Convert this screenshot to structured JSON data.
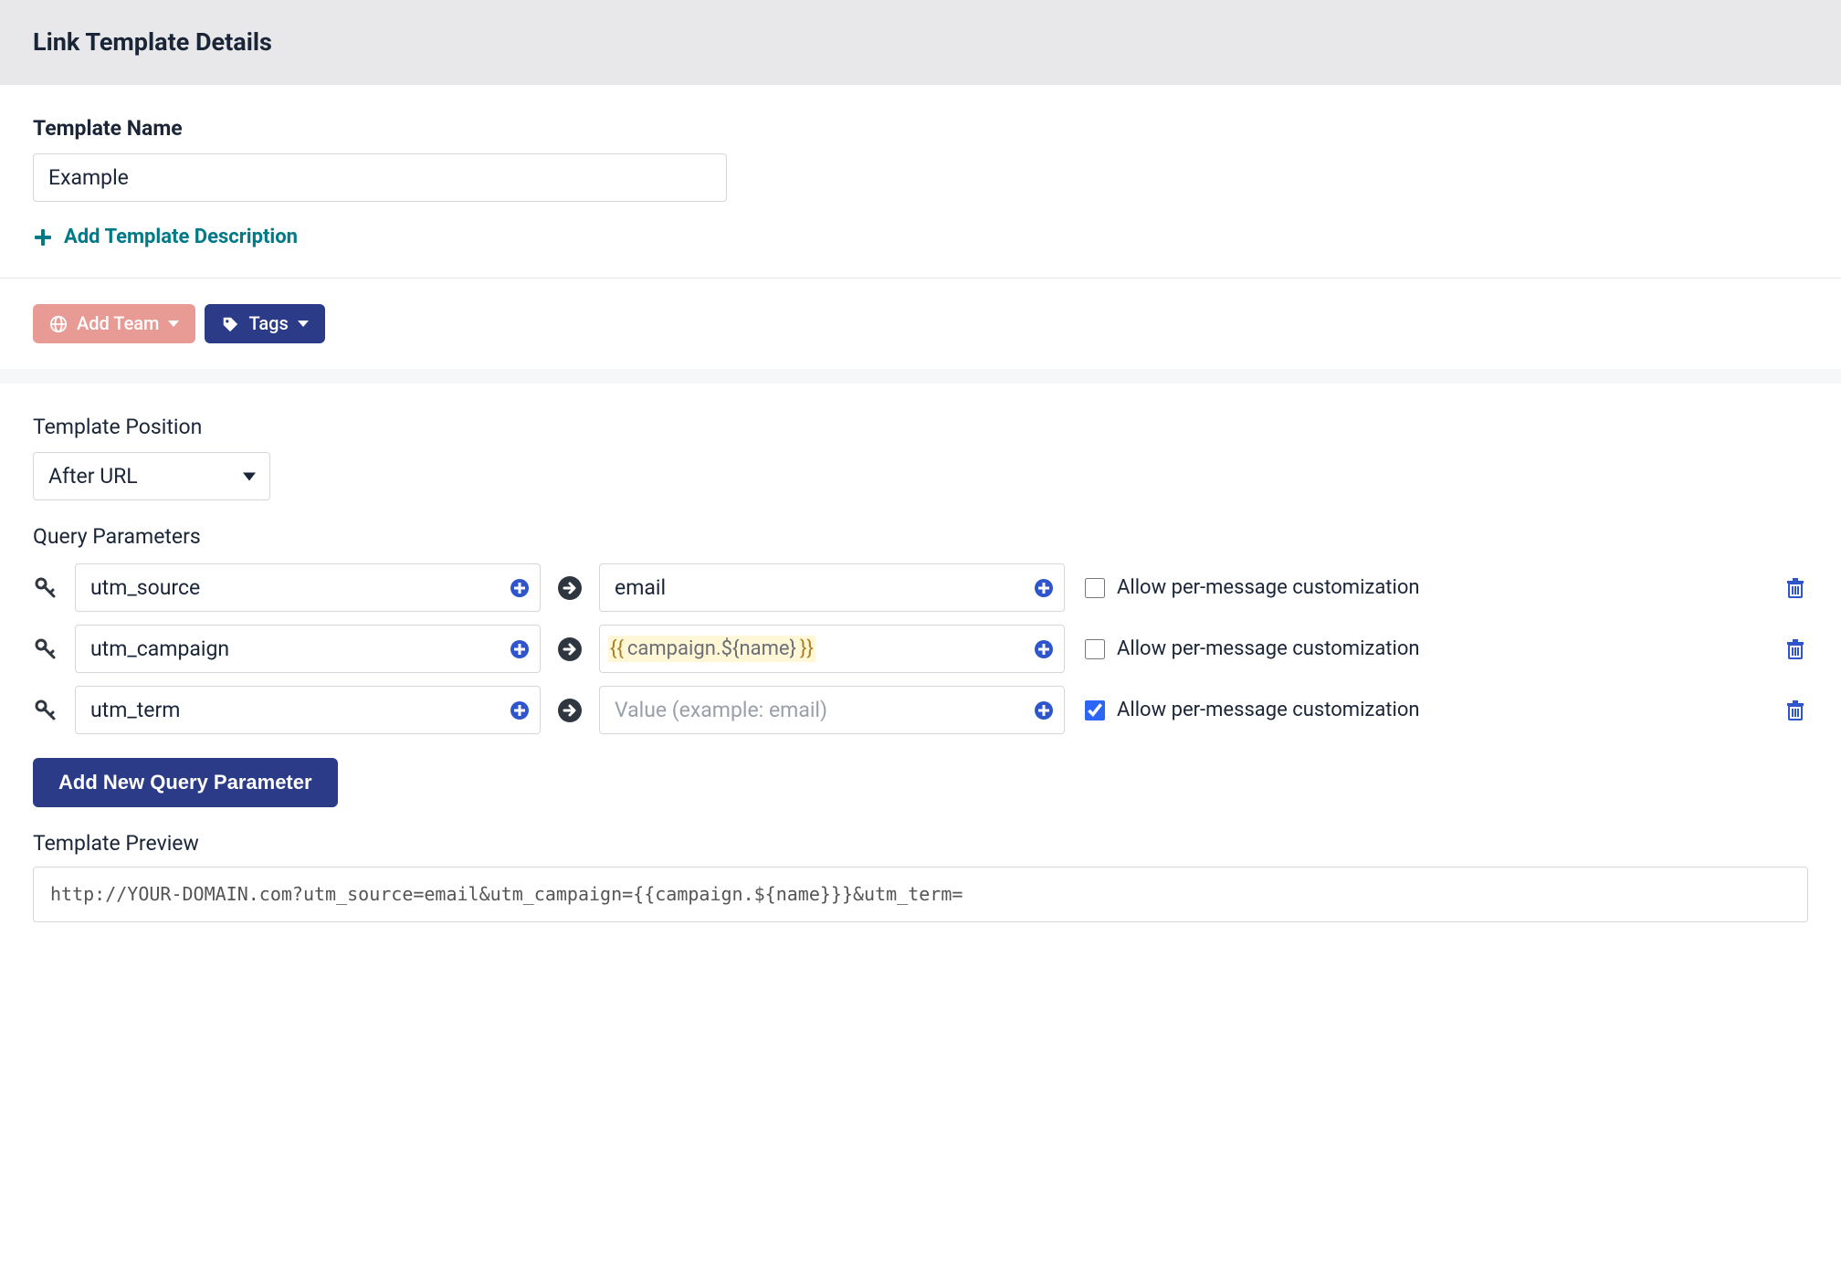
{
  "header": {
    "title": "Link Template Details"
  },
  "template_name": {
    "label": "Template Name",
    "value": "Example"
  },
  "add_description": {
    "label": "Add Template Description"
  },
  "pills": {
    "add_team": {
      "label": "Add Team"
    },
    "tags": {
      "label": "Tags"
    }
  },
  "position": {
    "label": "Template Position",
    "selected": "After URL"
  },
  "query_params": {
    "heading": "Query Parameters",
    "value_placeholder": "Value (example: email)",
    "allow_label": "Allow per-message customization",
    "rows": [
      {
        "key": "utm_source",
        "value_plain": "email",
        "value_templated": null,
        "allow": false
      },
      {
        "key": "utm_campaign",
        "value_plain": "",
        "value_templated": {
          "open": "{{",
          "inner": "campaign.${name}",
          "close": "}}"
        },
        "allow": false
      },
      {
        "key": "utm_term",
        "value_plain": "",
        "value_templated": null,
        "allow": true
      }
    ]
  },
  "add_new_param": {
    "label": "Add New Query Parameter"
  },
  "preview": {
    "label": "Template Preview",
    "value": "http://YOUR-DOMAIN.com?utm_source=email&utm_campaign={{campaign.${name}}}&utm_term="
  }
}
